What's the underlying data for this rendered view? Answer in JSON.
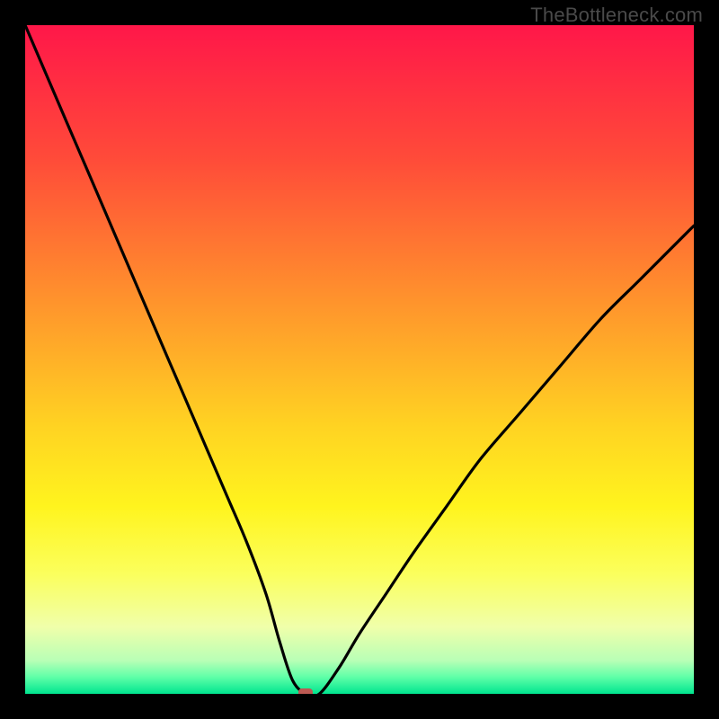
{
  "watermark": "TheBottleneck.com",
  "chart_data": {
    "type": "line",
    "title": "",
    "xlabel": "",
    "ylabel": "",
    "xlim": [
      0,
      100
    ],
    "ylim": [
      0,
      100
    ],
    "marker": {
      "x": 42,
      "y": 0,
      "color": "#bc5a53"
    },
    "gradient_stops": [
      {
        "offset": 0.0,
        "color": "#ff1749"
      },
      {
        "offset": 0.2,
        "color": "#ff4b39"
      },
      {
        "offset": 0.4,
        "color": "#ff8f2d"
      },
      {
        "offset": 0.6,
        "color": "#ffd322"
      },
      {
        "offset": 0.72,
        "color": "#fff41e"
      },
      {
        "offset": 0.82,
        "color": "#fbff5c"
      },
      {
        "offset": 0.9,
        "color": "#f0ffaa"
      },
      {
        "offset": 0.95,
        "color": "#b9ffb6"
      },
      {
        "offset": 0.975,
        "color": "#5fffa8"
      },
      {
        "offset": 1.0,
        "color": "#00e58f"
      }
    ],
    "series": [
      {
        "name": "bottleneck-curve",
        "x": [
          0,
          3,
          6,
          9,
          12,
          15,
          18,
          21,
          24,
          27,
          30,
          33,
          36,
          38,
          40,
          42,
          44,
          47,
          50,
          54,
          58,
          63,
          68,
          74,
          80,
          86,
          92,
          100
        ],
        "y": [
          100,
          93,
          86,
          79,
          72,
          65,
          58,
          51,
          44,
          37,
          30,
          23,
          15,
          8,
          2,
          0,
          0,
          4,
          9,
          15,
          21,
          28,
          35,
          42,
          49,
          56,
          62,
          70
        ]
      }
    ]
  }
}
